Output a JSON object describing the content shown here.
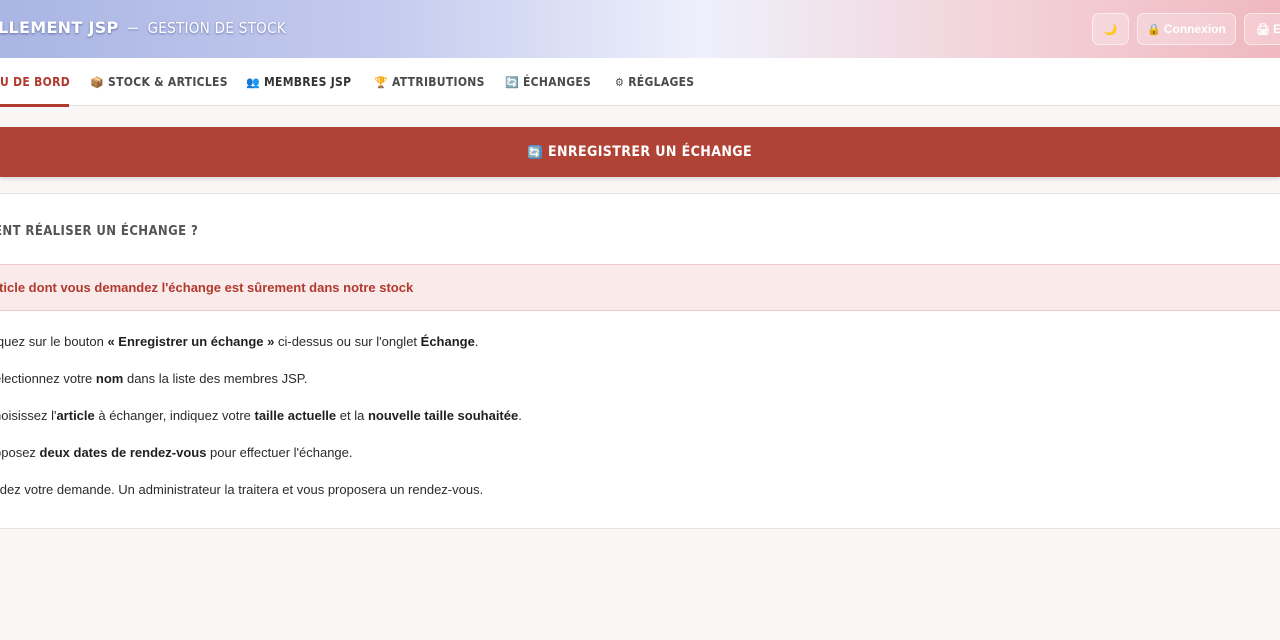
{
  "header": {
    "brand_name": "LLEMENT JSP",
    "brand_separator": "–",
    "brand_subtitle": "GESTION DE STOCK",
    "buttons": [
      {
        "icon": "moon-icon",
        "glyph": "🌙",
        "label": ""
      },
      {
        "icon": "lock-icon",
        "glyph": "🔒",
        "label": "Connexion"
      },
      {
        "icon": "printer-icon",
        "glyph": "🖨",
        "label": "E"
      }
    ]
  },
  "nav": {
    "tabs": [
      {
        "label": "U DE BORD",
        "icon": "",
        "active": true
      },
      {
        "label": "STOCK & ARTICLES",
        "icon": "📦",
        "active": false
      },
      {
        "label": "MEMBRES JSP",
        "icon": "👥",
        "active": false
      },
      {
        "label": "ATTRIBUTIONS",
        "icon": "🏆",
        "active": false
      },
      {
        "label": "ÉCHANGES",
        "icon": "🔄",
        "active": false
      },
      {
        "label": "RÉGLAGES",
        "icon": "⚙",
        "active": false
      }
    ]
  },
  "action": {
    "icon": "🔄",
    "label": "ENREGISTRER UN ÉCHANGE"
  },
  "help": {
    "title": "ENT RÉALISER UN ÉCHANGE ?",
    "alert": "rticle dont vous demandez l'échange est sûrement dans notre stock",
    "steps": [
      {
        "parts": [
          "iquez sur le bouton ",
          "« Enregistrer un échange »",
          " ci-dessus ou sur l'onglet ",
          "Échange",
          "."
        ]
      },
      {
        "parts": [
          "électionnez votre ",
          "nom",
          " dans la liste des membres JSP."
        ]
      },
      {
        "parts": [
          "hoisissez l'",
          "article",
          " à échanger, indiquez votre ",
          "taille actuelle",
          " et la ",
          "nouvelle taille souhaitée",
          "."
        ]
      },
      {
        "parts": [
          "oposez ",
          "deux dates de rendez-vous",
          " pour effectuer l'échange."
        ]
      },
      {
        "parts": [
          "lidez votre demande. Un administrateur la traitera et vous proposera un rendez-vous."
        ]
      }
    ]
  },
  "colors": {
    "accent": "#b03a2e",
    "action_bar": "#b04335",
    "alert_bg": "#fbeaea",
    "page_bg": "#f9f7f5"
  }
}
